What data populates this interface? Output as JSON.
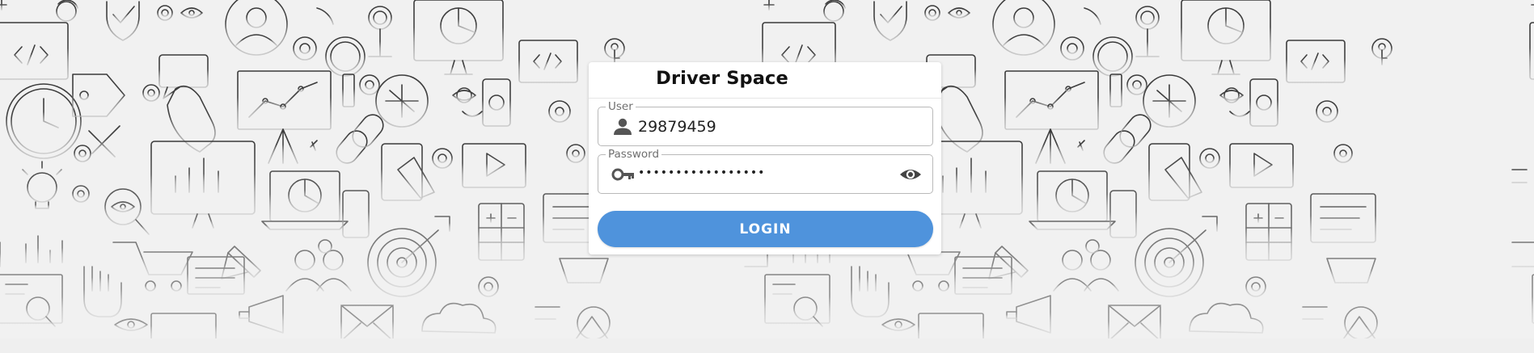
{
  "login": {
    "title": "Driver Space",
    "user": {
      "label": "User",
      "value": "29879459"
    },
    "password": {
      "label": "Password",
      "masked_value": "•••••••••••••••••"
    },
    "button_label": "LOGIN"
  },
  "icons": {
    "user": "person-icon",
    "password": "key-icon",
    "toggle": "eye-icon"
  },
  "colors": {
    "accent": "#4f93dc",
    "background": "#f1f1f1",
    "doodle_line": "#3a3a3a"
  }
}
